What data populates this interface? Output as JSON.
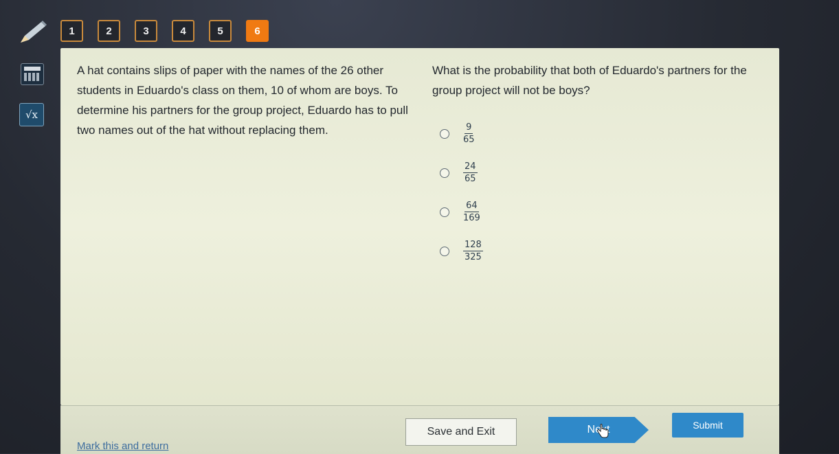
{
  "question_nav": [
    "1",
    "2",
    "3",
    "4",
    "5",
    "6"
  ],
  "active_question": "6",
  "tools": {
    "pencil_icon": "pencil-icon",
    "calculator_icon": "calculator-icon",
    "reference_icon": "sqrt-icon",
    "reference_label": "√x"
  },
  "passage": "A hat contains slips of paper with the names of the 26 other students in Eduardo's class on them, 10 of whom are boys. To determine his partners for the group project, Eduardo has to pull two names out of the hat without replacing them.",
  "question": "What is the probability that both of Eduardo's partners for the group project will not be boys?",
  "choices": [
    {
      "numerator": "9",
      "denominator": "65"
    },
    {
      "numerator": "24",
      "denominator": "65"
    },
    {
      "numerator": "64",
      "denominator": "169"
    },
    {
      "numerator": "128",
      "denominator": "325"
    }
  ],
  "footer": {
    "mark_label": "Mark this and return",
    "save_label": "Save and Exit",
    "next_label": "Next",
    "submit_label": "Submit"
  },
  "colors": {
    "accent": "#f07a12",
    "button_blue": "#2f89c9",
    "panel_bg": "#eceedb"
  }
}
